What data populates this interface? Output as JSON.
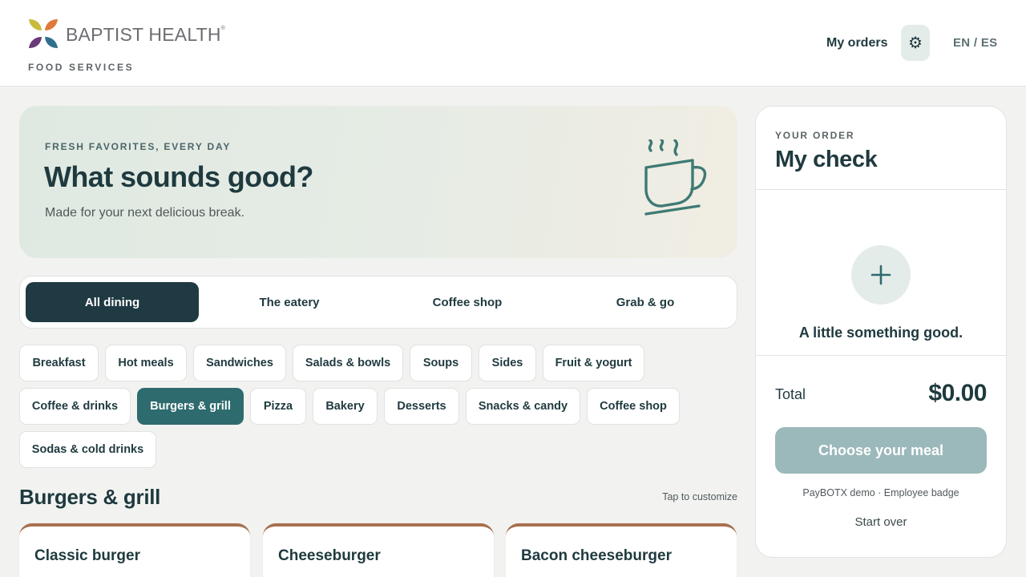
{
  "header": {
    "brand_name": "BAPTIST HEALTH",
    "brand_mark": "®",
    "brand_sub": "FOOD SERVICES",
    "my_orders": "My orders",
    "settings_icon": "gear-icon",
    "settings_glyph": "⚙",
    "language": "EN / ES"
  },
  "hero": {
    "kicker": "FRESH FAVORITES, EVERY DAY",
    "title": "What sounds good?",
    "subtitle": "Made for your next delicious break.",
    "icon": "coffee-cup-icon"
  },
  "tabs": [
    {
      "label": "All dining",
      "active": true
    },
    {
      "label": "The eatery",
      "active": false
    },
    {
      "label": "Coffee shop",
      "active": false
    },
    {
      "label": "Grab & go",
      "active": false
    }
  ],
  "categories": [
    {
      "label": "Breakfast"
    },
    {
      "label": "Hot meals"
    },
    {
      "label": "Sandwiches"
    },
    {
      "label": "Salads & bowls"
    },
    {
      "label": "Soups"
    },
    {
      "label": "Sides"
    },
    {
      "label": "Fruit & yogurt"
    },
    {
      "label": "Coffee & drinks"
    },
    {
      "label": "Burgers & grill",
      "active": true
    },
    {
      "label": "Pizza"
    },
    {
      "label": "Bakery"
    },
    {
      "label": "Desserts"
    },
    {
      "label": "Snacks & candy"
    },
    {
      "label": "Coffee shop"
    },
    {
      "label": "Sodas & cold drinks"
    }
  ],
  "section": {
    "title": "Burgers & grill",
    "hint": "Tap to customize",
    "items": [
      {
        "name": "Classic burger"
      },
      {
        "name": "Cheeseburger"
      },
      {
        "name": "Bacon cheeseburger"
      }
    ]
  },
  "order": {
    "kicker": "YOUR ORDER",
    "title": "My check",
    "empty_message": "A little something good.",
    "add_icon": "plus-icon",
    "total_label": "Total",
    "total_value": "$0.00",
    "cta": "Choose your meal",
    "payment_note": "PayBOTX demo · Employee badge",
    "start_over": "Start over"
  },
  "colors": {
    "primary_dark": "#1f3a42",
    "accent_teal": "#2e6b6e",
    "card_accent": "#a8704f",
    "cta_disabled": "#9bb8ba"
  }
}
